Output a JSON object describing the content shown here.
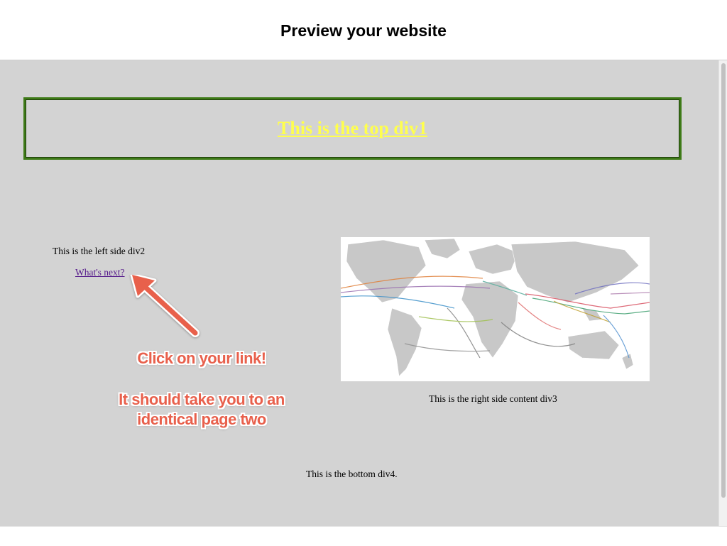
{
  "header": {
    "title": "Preview your website"
  },
  "preview": {
    "top_div_link": "This is the top div1",
    "left_div_text": "This is the left side div2",
    "next_link": "What's next?",
    "right_div_text": "This is the right side content div3",
    "bottom_div_text": "This is the bottom div4.",
    "map_image": "world submarine cable map"
  },
  "annotations": {
    "callout_1": "Click on your link!",
    "callout_2_line_1": "It should take you to an",
    "callout_2_line_2": "identical page two",
    "arrow": "arrow-pointing-to-link"
  },
  "colors": {
    "preview_bg": "#d3d3d3",
    "top_border": "#3e7a17",
    "top_link": "#ffff4d",
    "visited_link": "#551a8b",
    "callout": "#e8604c"
  }
}
